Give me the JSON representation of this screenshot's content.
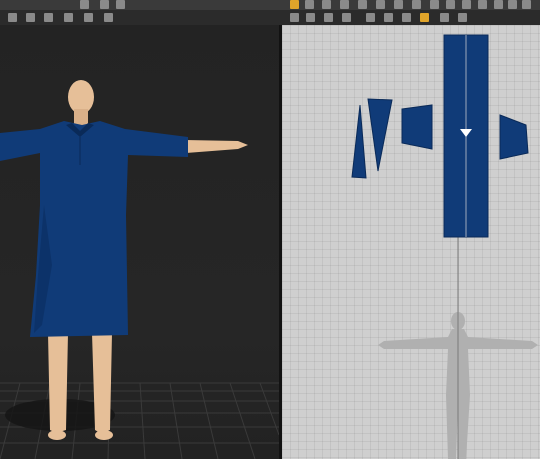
{
  "toolbar": {
    "left_icons": [
      "move-icon",
      "line-icon",
      "select-icon",
      "image-icon",
      "layout-icon",
      "grid-icon",
      "rotate-icon",
      "pin-icon"
    ],
    "right_icons_top": [
      "pattern-tool-icon",
      "edit-point-icon",
      "curve-icon",
      "polygon-icon",
      "rectangle-icon",
      "circle-icon",
      "dart-icon",
      "notch-icon",
      "sewing-icon",
      "fold-icon",
      "tack-icon",
      "button-icon",
      "zipper-icon",
      "texture-icon",
      "measure-icon",
      "annotate-icon",
      "settings-icon"
    ],
    "right_icons_bottom": [
      "segment-sew-icon",
      "free-sew-icon",
      "check-sew-icon",
      "trace-icon",
      "pin-2d-icon",
      "fabric-icon",
      "internal-line-icon",
      "hole-icon",
      "transform-icon",
      "graphic-icon",
      "snapshot-icon",
      "highlight-icon",
      "grade-icon"
    ]
  },
  "viewport_3d": {
    "garment_color": "#103b78",
    "skin_color": "#e6bf98"
  },
  "viewport_2d": {
    "pattern_color": "#103b78",
    "pattern_pieces": [
      "sleeve-piece-left",
      "sleeve-piece-right",
      "collar-piece",
      "front-body-piece",
      "cuff-piece"
    ]
  }
}
